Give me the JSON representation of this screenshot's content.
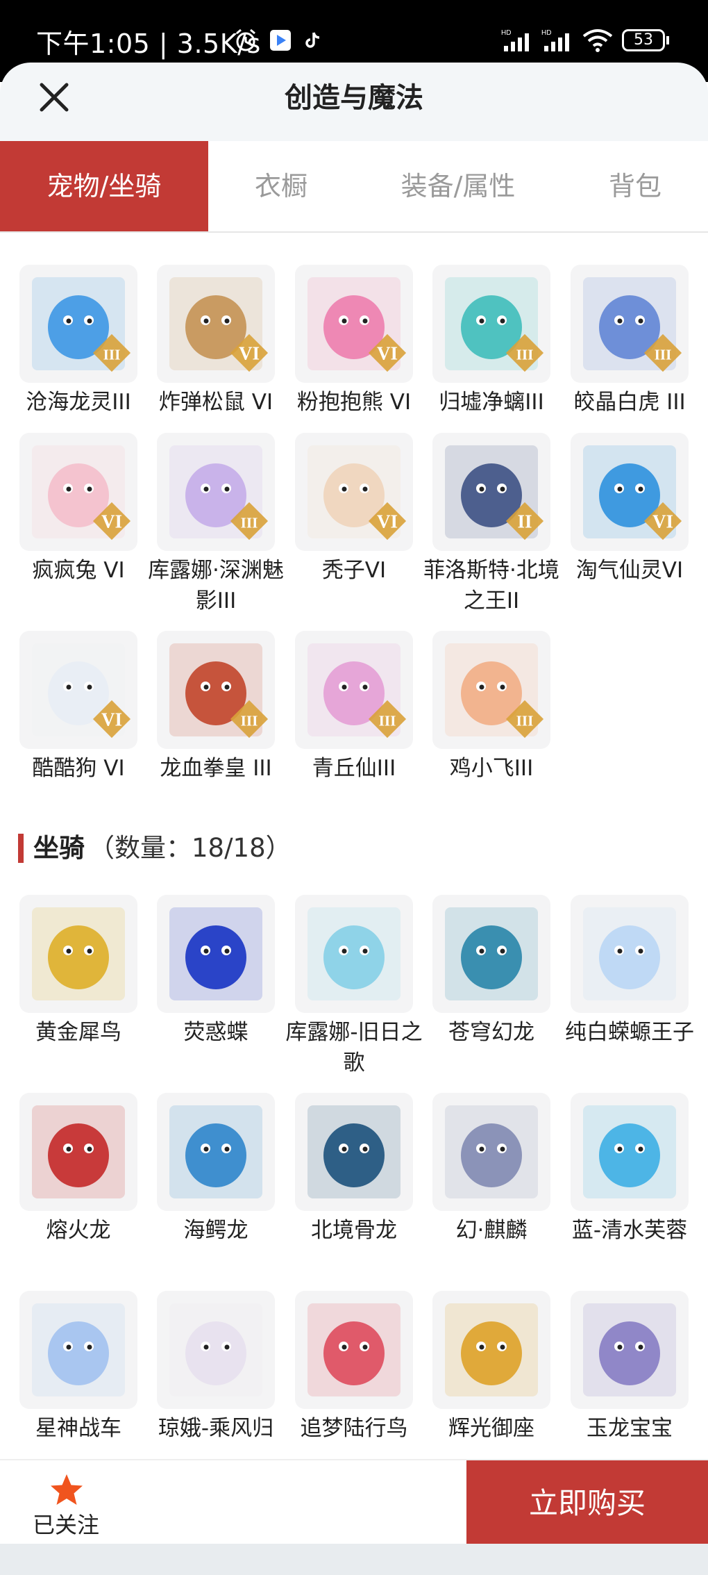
{
  "status": {
    "time": "下午1:05 | 3.5K/s",
    "battery": "53",
    "network_labels": [
      "HD",
      "HD"
    ]
  },
  "header": {
    "title": "创造与魔法"
  },
  "tabs": [
    {
      "label": "宠物/坐骑",
      "active": true
    },
    {
      "label": "衣橱",
      "active": false
    },
    {
      "label": "装备/属性",
      "active": false
    },
    {
      "label": "背包",
      "active": false
    }
  ],
  "pets": [
    {
      "name": "沧海龙灵III",
      "rank": "III",
      "color": "#4d9fe6"
    },
    {
      "name": "炸弹松鼠 VI",
      "rank": "VI",
      "color": "#c99b62"
    },
    {
      "name": "粉抱抱熊 VI",
      "rank": "VI",
      "color": "#ee88b4"
    },
    {
      "name": "归墟净螭III",
      "rank": "III",
      "color": "#4fc2c0"
    },
    {
      "name": "皎晶白虎 III",
      "rank": "III",
      "color": "#6e8fd8"
    },
    {
      "name": "疯疯兔 VI",
      "rank": "VI",
      "color": "#f4c3cf"
    },
    {
      "name": "库露娜·深渊魅影III",
      "rank": "III",
      "color": "#c9b3ea"
    },
    {
      "name": "秃子VI",
      "rank": "VI",
      "color": "#f0d7c0"
    },
    {
      "name": "菲洛斯特·北境之王II",
      "rank": "II",
      "color": "#4d5f8e"
    },
    {
      "name": "淘气仙灵VI",
      "rank": "VI",
      "color": "#3f9ae0"
    },
    {
      "name": "酷酷狗 VI",
      "rank": "VI",
      "color": "#e9eef5"
    },
    {
      "name": "龙血拳皇 III",
      "rank": "III",
      "color": "#c6543c"
    },
    {
      "name": "青丘仙III",
      "rank": "III",
      "color": "#e6a6d8"
    },
    {
      "name": "鸡小飞III",
      "rank": "III",
      "color": "#f2b48f"
    }
  ],
  "mounts_section": {
    "title": "坐骑",
    "count": "（数量：18/18）"
  },
  "mounts": [
    {
      "name": "黄金犀鸟",
      "color": "#e0b53a"
    },
    {
      "name": "荧惑蝶",
      "color": "#2a44c8"
    },
    {
      "name": "库露娜-旧日之歌",
      "color": "#8fd3e8"
    },
    {
      "name": "苍穹幻龙",
      "color": "#3a8fb0"
    },
    {
      "name": "纯白蝾螈王子",
      "color": "#bfd9f5"
    },
    {
      "name": "熔火龙",
      "color": "#c83a3a"
    },
    {
      "name": "海鳄龙",
      "color": "#3f8fcf"
    },
    {
      "name": "北境骨龙",
      "color": "#2e5f86"
    },
    {
      "name": "幻·麒麟",
      "color": "#8b93b8"
    },
    {
      "name": "蓝-清水芙蓉",
      "color": "#4db5e6"
    },
    {
      "name": "星神战车",
      "color": "#a9c6f0"
    },
    {
      "name": "琼娥-乘风归",
      "color": "#e8e2ef"
    },
    {
      "name": "追梦陆行鸟",
      "color": "#e05a6a"
    },
    {
      "name": "辉光御座",
      "color": "#e0a93a"
    },
    {
      "name": "玉龙宝宝",
      "color": "#9087c8"
    }
  ],
  "footer": {
    "follow_label": "已关注",
    "buy_label": "立即购买"
  },
  "colors": {
    "accent": "#c23a35",
    "star": "#f0541e"
  }
}
